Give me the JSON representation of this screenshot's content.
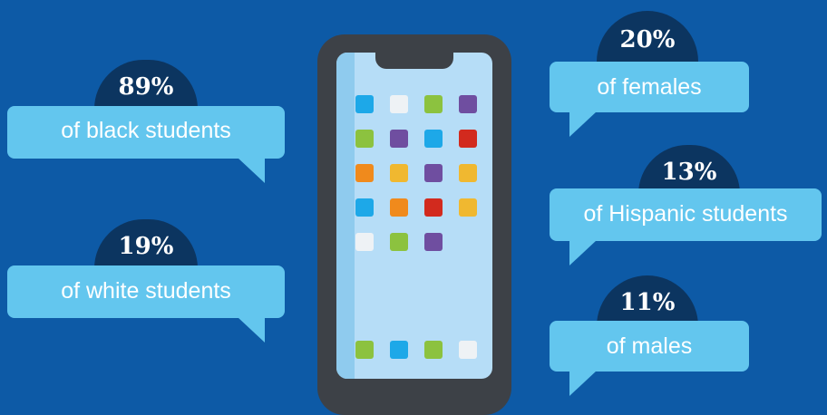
{
  "stats": [
    {
      "id": "black",
      "percent": "89%",
      "label": "of black students"
    },
    {
      "id": "white",
      "percent": "19%",
      "label": "of white students"
    },
    {
      "id": "females",
      "percent": "20%",
      "label": "of females"
    },
    {
      "id": "hispanic",
      "percent": "13%",
      "label": "of Hispanic students"
    },
    {
      "id": "males",
      "percent": "11%",
      "label": "of males"
    }
  ],
  "colors": {
    "background": "#0d5aa6",
    "bubble": "#63c6ee",
    "badge": "#0c3560",
    "phone": "#3d4147",
    "screen": "#b6ddf7"
  },
  "phone": {
    "app_icon_colors": [
      [
        "#1da8e8",
        "#eef2f5",
        "#8cc23f",
        "#6f4ea0"
      ],
      [
        "#8cc23f",
        "#6f4ea0",
        "#1da8e8",
        "#d22a1e"
      ],
      [
        "#f08a1c",
        "#f0b830",
        "#6f4ea0",
        "#f0b830"
      ],
      [
        "#1da8e8",
        "#f08a1c",
        "#d22a1e",
        "#f0b830"
      ],
      [
        "#eef2f5",
        "#8cc23f",
        "#6f4ea0"
      ]
    ],
    "dock_icon_colors": [
      "#8cc23f",
      "#1da8e8",
      "#8cc23f",
      "#eef2f5"
    ]
  }
}
